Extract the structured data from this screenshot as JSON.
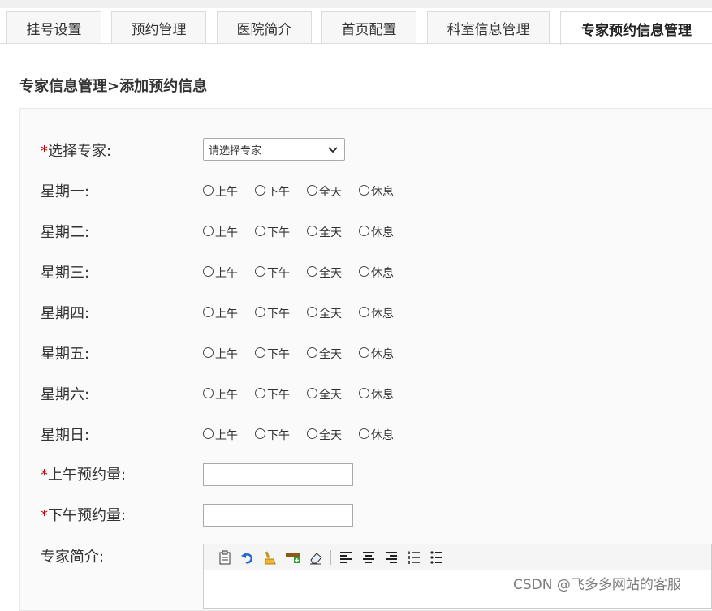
{
  "tabs": [
    {
      "label": "挂号设置"
    },
    {
      "label": "预约管理"
    },
    {
      "label": "医院简介"
    },
    {
      "label": "首页配置"
    },
    {
      "label": "科室信息管理"
    },
    {
      "label": "专家预约信息管理",
      "active": true
    }
  ],
  "breadcrumb": "专家信息管理>添加预约信息",
  "form": {
    "expert_label": "选择专家:",
    "expert_select_value": "请选择专家",
    "required_mark": "*",
    "options": [
      "上午",
      "下午",
      "全天",
      "休息"
    ],
    "days": [
      "星期一:",
      "星期二:",
      "星期三:",
      "星期四:",
      "星期五:",
      "星期六:",
      "星期日:"
    ],
    "am_label": "上午预约量:",
    "am_value": "",
    "pm_label": "下午预约量:",
    "pm_value": "",
    "intro_label": "专家简介:"
  },
  "editor_toolbar": [
    "paste-icon",
    "undo-icon",
    "clear-format-icon",
    "insert-icon",
    "eraser-icon",
    "align-left-icon",
    "align-center-icon",
    "align-right-icon",
    "ordered-list-icon",
    "unordered-list-icon"
  ],
  "watermark": "CSDN @飞多多网站的客服"
}
